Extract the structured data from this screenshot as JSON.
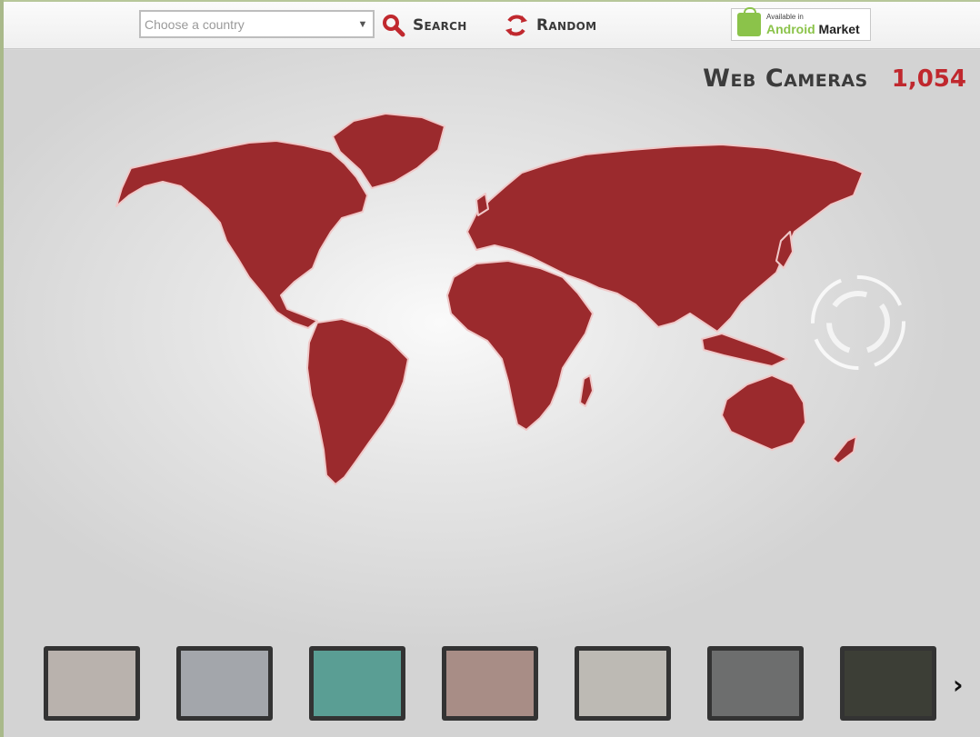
{
  "toolbar": {
    "country_placeholder": "Choose a country",
    "search_label": "Search",
    "random_label": "Random",
    "android_badge_small": "Available in",
    "android_badge_word1": "Android",
    "android_badge_word2": "Market"
  },
  "header": {
    "title": "Web Cameras",
    "camera_count": "1,054"
  },
  "colors": {
    "accent_red": "#c0282e",
    "map_land": "#9b2a2d",
    "android_green": "#8bc34a"
  },
  "icons": {
    "search": "magnifier-icon",
    "random": "circular-arrows-icon",
    "next": "chevron-right-icon"
  },
  "thumbnails": [
    {
      "name": "webcam-thumb-1",
      "tone": "#b9b2ad"
    },
    {
      "name": "webcam-thumb-2",
      "tone": "#a3a6ab"
    },
    {
      "name": "webcam-thumb-3",
      "tone": "#5a9e94"
    },
    {
      "name": "webcam-thumb-4",
      "tone": "#a88d86"
    },
    {
      "name": "webcam-thumb-5",
      "tone": "#bdbab4"
    },
    {
      "name": "webcam-thumb-6",
      "tone": "#6d6e6e"
    },
    {
      "name": "webcam-thumb-7",
      "tone": "#3c3e36"
    }
  ]
}
